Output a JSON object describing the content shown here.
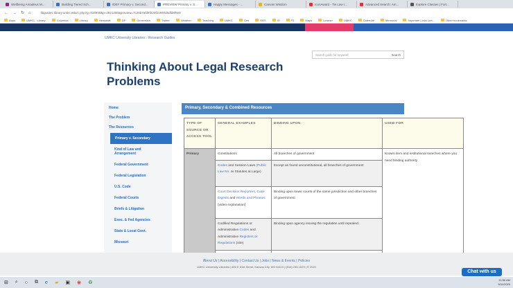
{
  "browser": {
    "tabs": [
      {
        "label": "Wellbeing Amadeus M..."
      },
      {
        "label": "Building Tiered Sch..."
      },
      {
        "label": "IDEF Primary v. Second..."
      },
      {
        "label": "PREVIEW Primary v. S...",
        "active": true
      },
      {
        "label": "Happy Messages - ..."
      },
      {
        "label": "Canvas Wisdom"
      },
      {
        "label": "IconAward - Tie Law I..."
      },
      {
        "label": "Advanced Search: Am..."
      },
      {
        "label": "Explore Classes | Fort..."
      }
    ],
    "url": "libguides.library.umkc.edu/c.php?g=419940&p=2921250&preview=7c26b7afd8f220f21940d5dfd8f5e0",
    "bookmarks": [
      "Apps",
      "UMKC - Library",
      "Columbia",
      "Library",
      "Hensdale",
      "DP",
      "Generation",
      "Twitter",
      "Weather",
      "Teaching",
      "UMKC",
      "Gen",
      "RRS",
      "IX",
      "P3",
      "Maps",
      "Learner",
      "UMKC",
      "Calendar",
      "Memorial",
      "Important Links Lea...",
      "Other bookmarks"
    ]
  },
  "breadcrumb": [
    "UMKC University Libraries",
    "Research Guides"
  ],
  "search": {
    "placeholder": "Search guide for keyword",
    "button": "Search"
  },
  "page_title": "Thinking About Legal Research Problems",
  "sidebar": [
    {
      "label": "Home"
    },
    {
      "label": "The Problem"
    },
    {
      "label": "The Resources"
    },
    {
      "label": "Primary v. Secondary",
      "active": true
    },
    {
      "label": "Kind of Law and Arrangement"
    },
    {
      "label": "Federal Government"
    },
    {
      "label": "Federal Legislation"
    },
    {
      "label": "U.S. Code"
    },
    {
      "label": "Federal Courts"
    },
    {
      "label": "Briefs & Litigation"
    },
    {
      "label": "Exec. & Fed Agencies"
    },
    {
      "label": "State & Local Govt."
    },
    {
      "label": "Missouri"
    }
  ],
  "section_title": "Primary, Secondary & Combined Resources",
  "table": {
    "headers": [
      "TYPE OF SOURCE OR ACCESS TOOL",
      "GENERAL EXAMPLES",
      "BINDING UPON",
      "USED FOR"
    ],
    "type": "Primary",
    "used_for": "Known item and institutional searches where you need binding authority",
    "rows": [
      {
        "ex": [
          "Constitutions"
        ],
        "binding": "All branches of government"
      },
      {
        "ex": [
          {
            "link": "Codes"
          },
          " and Session Laws ",
          {
            "link": "(Public Law No."
          },
          " or Statutes at Large)"
        ],
        "binding": "Except as found unconstitutional, all branches of government"
      },
      {
        "ex": [
          {
            "link": "Court Decision Reporters"
          },
          ", ",
          {
            "link": "Case Digests"
          },
          " and ",
          {
            "link": "Words and Phrases"
          },
          " (video explanation)"
        ],
        "binding": "Binding upon lower courts of the same jurisdiction and other branches of government"
      },
      {
        "ex": [
          "Codified Regulations or Administrative ",
          {
            "link": "Codes"
          },
          " and Administrative ",
          {
            "link": "Registers or Regulations"
          },
          " (site)"
        ],
        "binding": "Binding upon agency issuing the regulation until repealed."
      }
    ]
  },
  "footer": {
    "links": [
      "About Us",
      "Accessibility",
      "Contact Us",
      "Jobs",
      "News & Events",
      "Policies"
    ],
    "address": "UMKC University Libraries | 800 E 51st Street, Kansas City, MO 64110 | (816) 235-1529 | © 2020"
  },
  "chat": "Chat with us",
  "clock": {
    "time": "11:56 AM",
    "date": "5/11/2020"
  }
}
